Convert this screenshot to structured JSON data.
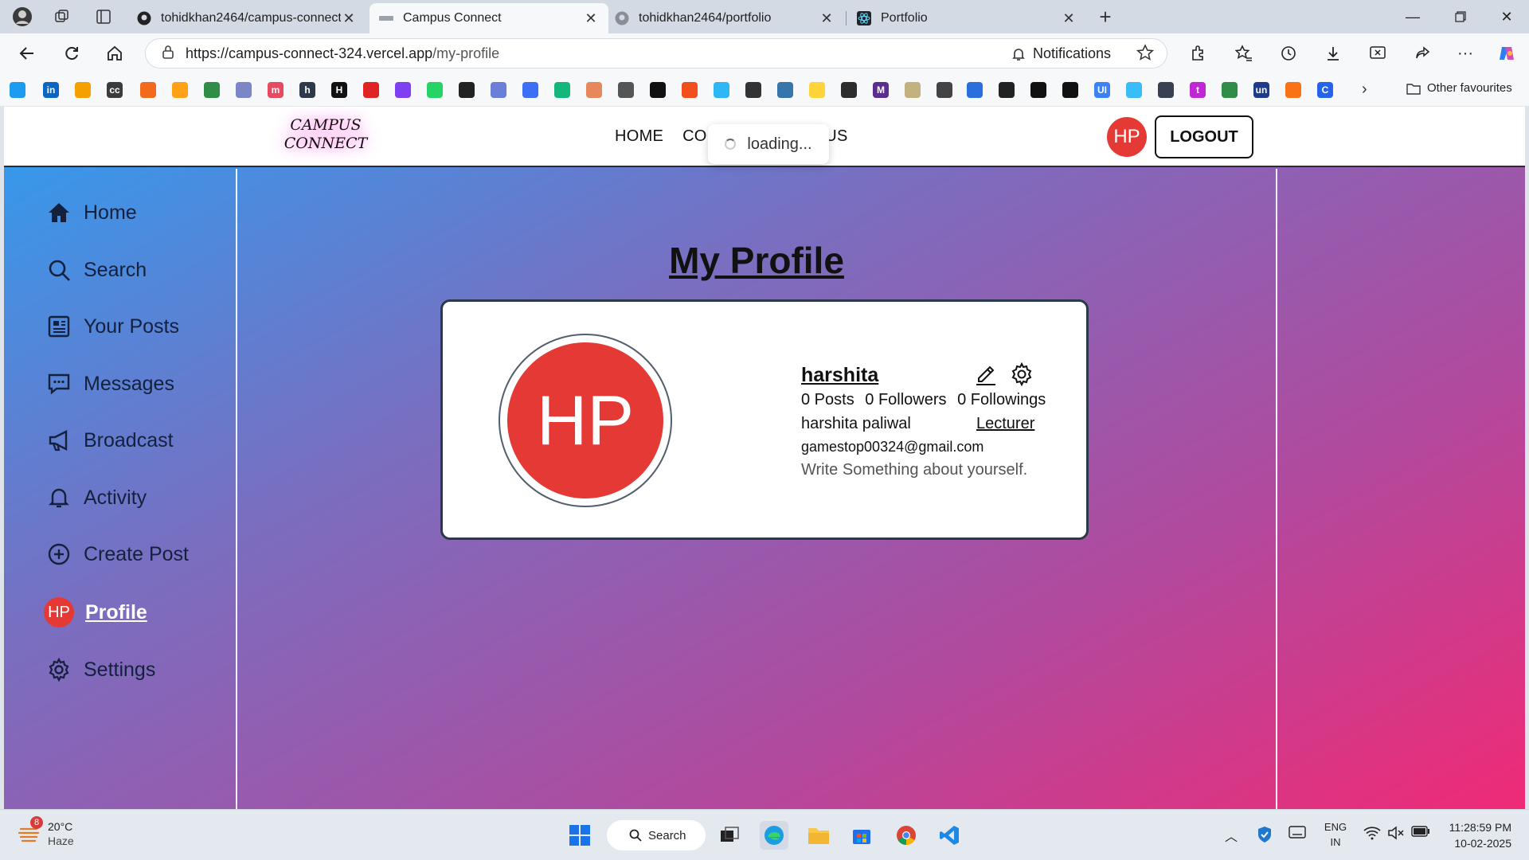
{
  "browser": {
    "tabs": [
      {
        "title": "tohidkhan2464/campus-connect",
        "active": false
      },
      {
        "title": "Campus Connect",
        "active": true
      },
      {
        "title": "tohidkhan2464/portfolio",
        "active": false
      },
      {
        "title": "Portfolio",
        "active": false
      }
    ],
    "url": {
      "host": "https://campus-connect-324.vercel.app",
      "path": "/my-profile"
    },
    "notifications_label": "Notifications",
    "other_favourites": "Other favourites"
  },
  "header": {
    "logo_line1": "CAMPUS",
    "logo_line2": "CONNECT",
    "nav": [
      "HOME",
      "CON",
      "T US"
    ],
    "loading_text": "loading...",
    "avatar_initials": "HP",
    "logout_label": "LOGOUT"
  },
  "sidebar": {
    "items": [
      {
        "label": "Home",
        "icon": "home-icon"
      },
      {
        "label": "Search",
        "icon": "search-icon"
      },
      {
        "label": "Your Posts",
        "icon": "posts-icon"
      },
      {
        "label": "Messages",
        "icon": "messages-icon"
      },
      {
        "label": "Broadcast",
        "icon": "megaphone-icon"
      },
      {
        "label": "Activity",
        "icon": "bell-icon"
      },
      {
        "label": "Create Post",
        "icon": "plus-circle-icon"
      },
      {
        "label": "Profile",
        "icon": "avatar",
        "initials": "HP",
        "active": true
      },
      {
        "label": "Settings",
        "icon": "gear-icon"
      }
    ]
  },
  "profile": {
    "page_title": "My Profile",
    "avatar_initials": "HP",
    "username": "harshita",
    "posts": "0 Posts",
    "followers": "0 Followers",
    "followings": "0 Followings",
    "full_name": "harshita paliwal",
    "role": "Lecturer",
    "email": "gamestop00324@gmail.com",
    "bio_placeholder": "Write Something about yourself."
  },
  "taskbar": {
    "weather_temp": "20°C",
    "weather_desc": "Haze",
    "weather_badge": "8",
    "search_label": "Search",
    "lang_line1": "ENG",
    "lang_line2": "IN",
    "time": "11:28:59 PM",
    "date": "10-02-2025"
  },
  "colors": {
    "accent_red": "#e53935",
    "gradient_start": "#2f9df0",
    "gradient_end": "#f02a76"
  }
}
